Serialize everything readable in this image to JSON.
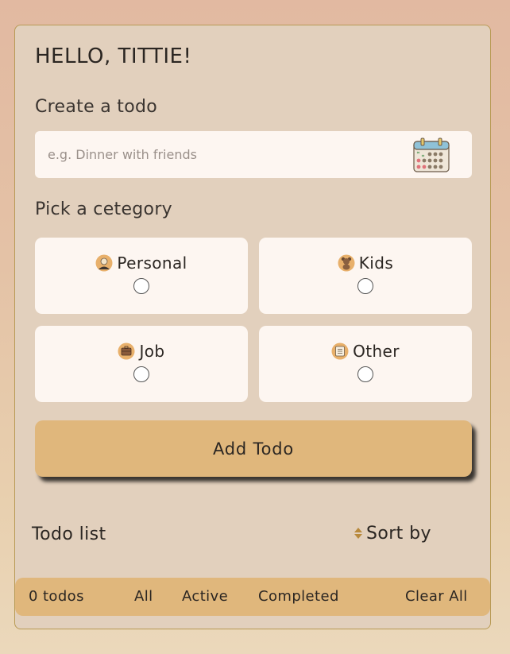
{
  "greeting": "HELLO, TITTIE!",
  "create": {
    "label": "Create a todo",
    "placeholder": "e.g. Dinner with friends",
    "calendar_icon": "calendar-icon"
  },
  "category": {
    "label": "Pick a cetegory",
    "options": [
      {
        "label": "Personal",
        "icon": "person-icon"
      },
      {
        "label": "Kids",
        "icon": "teddy-bear-icon"
      },
      {
        "label": "Job",
        "icon": "briefcase-icon"
      },
      {
        "label": "Other",
        "icon": "checklist-icon"
      }
    ]
  },
  "add_button": "Add Todo",
  "list": {
    "title": "Todo list",
    "sort_label": "Sort by"
  },
  "footer": {
    "count": "0 todos",
    "filters": [
      "All",
      "Active",
      "Completed"
    ],
    "clear": "Clear All"
  },
  "colors": {
    "accent": "#e0b77c",
    "card": "#e2d0bd",
    "field": "#fdf6f1",
    "border": "#b89a55"
  }
}
